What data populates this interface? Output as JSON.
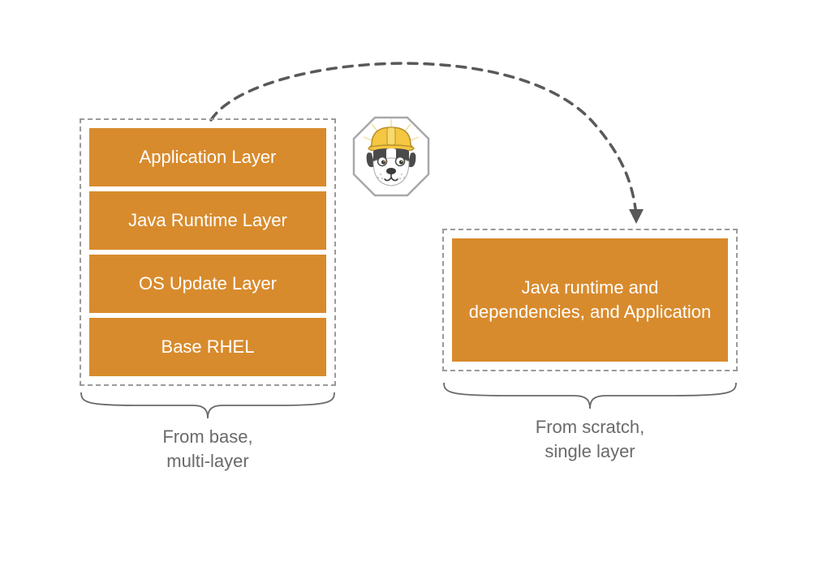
{
  "left_stack": {
    "layers": [
      "Application Layer",
      "Java Runtime Layer",
      "OS Update Layer",
      "Base RHEL"
    ],
    "caption_line1": "From base,",
    "caption_line2": "multi-layer"
  },
  "right_stack": {
    "layer_text": "Java runtime and dependencies, and Application",
    "caption_line1": "From scratch,",
    "caption_line2": "single layer"
  },
  "colors": {
    "box_fill": "#d88b2d",
    "text_on_box": "#ffffff",
    "dashed_border": "#9a9a9a",
    "caption_text": "#6a6a6a",
    "arrow": "#595959"
  },
  "mascot": {
    "description": "Cartoon dog face (bulldog) wearing a yellow construction hard hat, inside an octagonal white badge with grey outline",
    "name": "jib-mascot"
  }
}
